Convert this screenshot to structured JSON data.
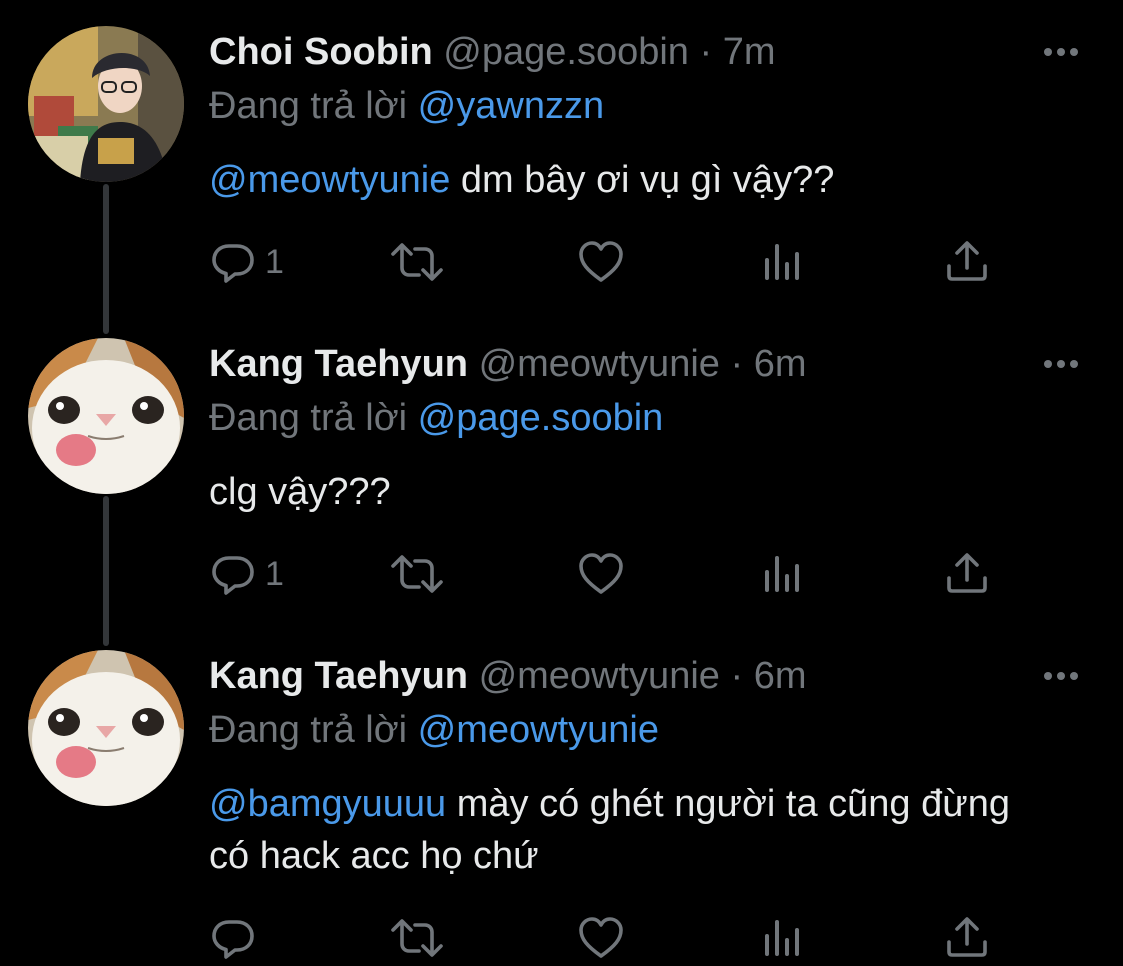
{
  "reply_prefix": "Đang trả lời",
  "tweets": [
    {
      "name": "Choi Soobin",
      "handle": "@page.soobin",
      "dot": "·",
      "time": "7m",
      "reply_to": "@yawnzzn",
      "text_mention": "@meowtyunie",
      "text": " dm bây ơi vụ gì vậy??",
      "reply_count": "1",
      "avatar": "person-photo"
    },
    {
      "name": "Kang Taehyun",
      "handle": "@meowtyunie",
      "dot": "·",
      "time": "6m",
      "reply_to": "@page.soobin",
      "text_mention": "",
      "text": "clg vậy???",
      "reply_count": "1",
      "avatar": "cat-photo"
    },
    {
      "name": "Kang Taehyun",
      "handle": "@meowtyunie",
      "dot": "·",
      "time": "6m",
      "reply_to": "@meowtyunie",
      "text_mention": "@bamgyuuuu",
      "text": " mày có ghét người ta cũng đừng có hack acc họ chứ",
      "reply_count": "",
      "avatar": "cat-photo"
    }
  ],
  "colors": {
    "background": "#000000",
    "primary_text": "#e7e9ea",
    "secondary_text": "#71767b",
    "mention": "#4a99e9",
    "thread_line": "#333639"
  },
  "icons": [
    "reply-icon",
    "retweet-icon",
    "like-icon",
    "views-icon",
    "share-icon",
    "more-icon"
  ]
}
